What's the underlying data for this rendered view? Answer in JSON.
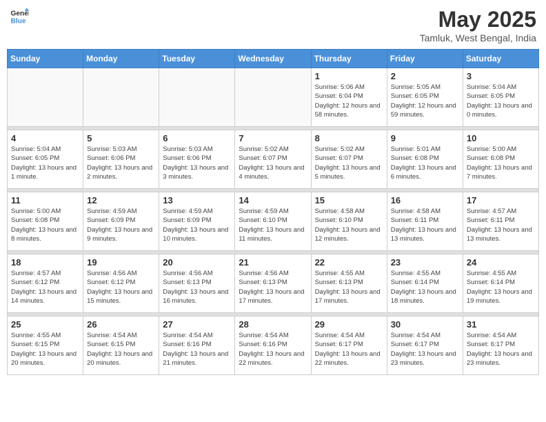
{
  "header": {
    "logo_line1": "General",
    "logo_line2": "Blue",
    "month": "May 2025",
    "location": "Tamluk, West Bengal, India"
  },
  "weekdays": [
    "Sunday",
    "Monday",
    "Tuesday",
    "Wednesday",
    "Thursday",
    "Friday",
    "Saturday"
  ],
  "weeks": [
    [
      {
        "day": "",
        "info": ""
      },
      {
        "day": "",
        "info": ""
      },
      {
        "day": "",
        "info": ""
      },
      {
        "day": "",
        "info": ""
      },
      {
        "day": "1",
        "info": "Sunrise: 5:06 AM\nSunset: 6:04 PM\nDaylight: 12 hours\nand 58 minutes."
      },
      {
        "day": "2",
        "info": "Sunrise: 5:05 AM\nSunset: 6:05 PM\nDaylight: 12 hours\nand 59 minutes."
      },
      {
        "day": "3",
        "info": "Sunrise: 5:04 AM\nSunset: 6:05 PM\nDaylight: 13 hours\nand 0 minutes."
      }
    ],
    [
      {
        "day": "4",
        "info": "Sunrise: 5:04 AM\nSunset: 6:05 PM\nDaylight: 13 hours\nand 1 minute."
      },
      {
        "day": "5",
        "info": "Sunrise: 5:03 AM\nSunset: 6:06 PM\nDaylight: 13 hours\nand 2 minutes."
      },
      {
        "day": "6",
        "info": "Sunrise: 5:03 AM\nSunset: 6:06 PM\nDaylight: 13 hours\nand 3 minutes."
      },
      {
        "day": "7",
        "info": "Sunrise: 5:02 AM\nSunset: 6:07 PM\nDaylight: 13 hours\nand 4 minutes."
      },
      {
        "day": "8",
        "info": "Sunrise: 5:02 AM\nSunset: 6:07 PM\nDaylight: 13 hours\nand 5 minutes."
      },
      {
        "day": "9",
        "info": "Sunrise: 5:01 AM\nSunset: 6:08 PM\nDaylight: 13 hours\nand 6 minutes."
      },
      {
        "day": "10",
        "info": "Sunrise: 5:00 AM\nSunset: 6:08 PM\nDaylight: 13 hours\nand 7 minutes."
      }
    ],
    [
      {
        "day": "11",
        "info": "Sunrise: 5:00 AM\nSunset: 6:08 PM\nDaylight: 13 hours\nand 8 minutes."
      },
      {
        "day": "12",
        "info": "Sunrise: 4:59 AM\nSunset: 6:09 PM\nDaylight: 13 hours\nand 9 minutes."
      },
      {
        "day": "13",
        "info": "Sunrise: 4:59 AM\nSunset: 6:09 PM\nDaylight: 13 hours\nand 10 minutes."
      },
      {
        "day": "14",
        "info": "Sunrise: 4:59 AM\nSunset: 6:10 PM\nDaylight: 13 hours\nand 11 minutes."
      },
      {
        "day": "15",
        "info": "Sunrise: 4:58 AM\nSunset: 6:10 PM\nDaylight: 13 hours\nand 12 minutes."
      },
      {
        "day": "16",
        "info": "Sunrise: 4:58 AM\nSunset: 6:11 PM\nDaylight: 13 hours\nand 13 minutes."
      },
      {
        "day": "17",
        "info": "Sunrise: 4:57 AM\nSunset: 6:11 PM\nDaylight: 13 hours\nand 13 minutes."
      }
    ],
    [
      {
        "day": "18",
        "info": "Sunrise: 4:57 AM\nSunset: 6:12 PM\nDaylight: 13 hours\nand 14 minutes."
      },
      {
        "day": "19",
        "info": "Sunrise: 4:56 AM\nSunset: 6:12 PM\nDaylight: 13 hours\nand 15 minutes."
      },
      {
        "day": "20",
        "info": "Sunrise: 4:56 AM\nSunset: 6:13 PM\nDaylight: 13 hours\nand 16 minutes."
      },
      {
        "day": "21",
        "info": "Sunrise: 4:56 AM\nSunset: 6:13 PM\nDaylight: 13 hours\nand 17 minutes."
      },
      {
        "day": "22",
        "info": "Sunrise: 4:55 AM\nSunset: 6:13 PM\nDaylight: 13 hours\nand 17 minutes."
      },
      {
        "day": "23",
        "info": "Sunrise: 4:55 AM\nSunset: 6:14 PM\nDaylight: 13 hours\nand 18 minutes."
      },
      {
        "day": "24",
        "info": "Sunrise: 4:55 AM\nSunset: 6:14 PM\nDaylight: 13 hours\nand 19 minutes."
      }
    ],
    [
      {
        "day": "25",
        "info": "Sunrise: 4:55 AM\nSunset: 6:15 PM\nDaylight: 13 hours\nand 20 minutes."
      },
      {
        "day": "26",
        "info": "Sunrise: 4:54 AM\nSunset: 6:15 PM\nDaylight: 13 hours\nand 20 minutes."
      },
      {
        "day": "27",
        "info": "Sunrise: 4:54 AM\nSunset: 6:16 PM\nDaylight: 13 hours\nand 21 minutes."
      },
      {
        "day": "28",
        "info": "Sunrise: 4:54 AM\nSunset: 6:16 PM\nDaylight: 13 hours\nand 22 minutes."
      },
      {
        "day": "29",
        "info": "Sunrise: 4:54 AM\nSunset: 6:17 PM\nDaylight: 13 hours\nand 22 minutes."
      },
      {
        "day": "30",
        "info": "Sunrise: 4:54 AM\nSunset: 6:17 PM\nDaylight: 13 hours\nand 23 minutes."
      },
      {
        "day": "31",
        "info": "Sunrise: 4:54 AM\nSunset: 6:17 PM\nDaylight: 13 hours\nand 23 minutes."
      }
    ]
  ]
}
